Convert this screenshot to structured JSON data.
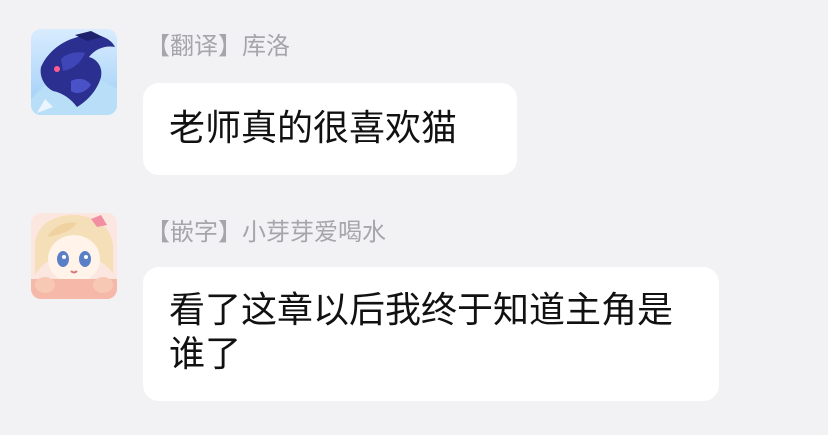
{
  "messages": [
    {
      "sender": "【翻译】库洛",
      "text": "老师真的很喜欢猫",
      "avatar_icon": "dark-blue-creature-avatar"
    },
    {
      "sender": "【嵌字】小芽芽爱喝水",
      "text": "看了这章以后我终于知道主角是谁了",
      "avatar_icon": "anime-girl-avatar"
    }
  ],
  "colors": {
    "background": "#f2f2f4",
    "bubble": "#ffffff",
    "sender_text": "#a5a5ab",
    "message_text": "#111111"
  }
}
